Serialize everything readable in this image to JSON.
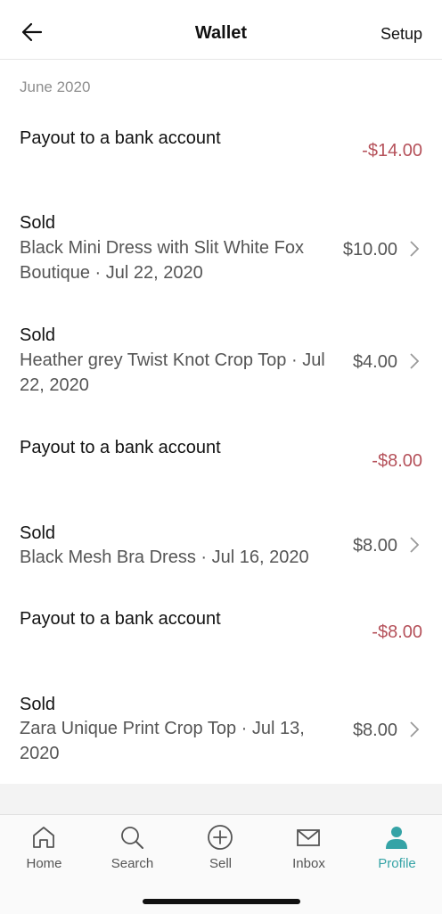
{
  "header": {
    "title": "Wallet",
    "setup_label": "Setup",
    "back_icon": "arrow-left-icon"
  },
  "section": {
    "label": "June 2020"
  },
  "rows": [
    {
      "head": "Payout to a bank account",
      "desc": "",
      "amount": "-$14.00",
      "negative": true,
      "chevron": false
    },
    {
      "head": "Sold",
      "desc": "Black Mini Dress with Slit White Fox Boutique · Jul 22, 2020",
      "amount": "$10.00",
      "negative": false,
      "chevron": true
    },
    {
      "head": "Sold",
      "desc": "Heather grey Twist Knot Crop Top · Jul 22, 2020",
      "amount": "$4.00",
      "negative": false,
      "chevron": true
    },
    {
      "head": "Payout to a bank account",
      "desc": "",
      "amount": "-$8.00",
      "negative": true,
      "chevron": false
    },
    {
      "head": "Sold",
      "desc": "Black Mesh Bra Dress · Jul 16, 2020",
      "amount": "$8.00",
      "negative": false,
      "chevron": true
    },
    {
      "head": "Payout to a bank account",
      "desc": "",
      "amount": "-$8.00",
      "negative": true,
      "chevron": false
    },
    {
      "head": "Sold",
      "desc": "Zara Unique Print Crop Top · Jul 13, 2020",
      "amount": "$8.00",
      "negative": false,
      "chevron": true
    }
  ],
  "tabs": [
    {
      "label": "Home",
      "icon": "home-icon",
      "active": false
    },
    {
      "label": "Search",
      "icon": "search-icon",
      "active": false
    },
    {
      "label": "Sell",
      "icon": "plus-circle-icon",
      "active": false
    },
    {
      "label": "Inbox",
      "icon": "mail-icon",
      "active": false
    },
    {
      "label": "Profile",
      "icon": "person-icon",
      "active": true
    }
  ],
  "colors": {
    "negative_amount": "#b5515a",
    "accent": "#35a3a6"
  }
}
